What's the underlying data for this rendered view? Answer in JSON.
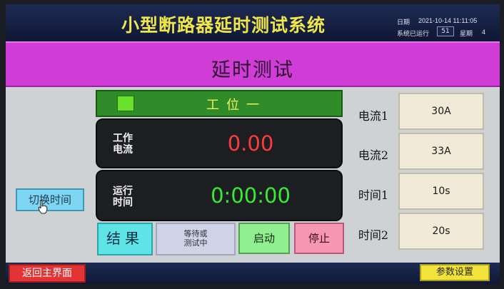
{
  "header": {
    "title": "小型断路器延时测试系统",
    "date_label": "日期",
    "datetime": "2021-10-14 11:11:05",
    "runtime_label": "系统已运行",
    "runtime_value": "51",
    "weekday_label": "星期",
    "weekday_value": "4"
  },
  "page": {
    "title": "延时测试"
  },
  "station": {
    "label": "工位一",
    "indicator_color": "#69e02a"
  },
  "current": {
    "label_line1": "工作",
    "label_line2": "电流",
    "value": "0.00"
  },
  "runtime": {
    "label_line1": "运行",
    "label_line2": "时间",
    "value": "0:00:00"
  },
  "controls": {
    "result_label": "结果",
    "status_line1": "等待或",
    "status_line2": "测试中",
    "start_label": "启动",
    "stop_label": "停止",
    "switch_time_label": "切换时间"
  },
  "params": [
    {
      "label": "电流1",
      "value": "30A"
    },
    {
      "label": "电流2",
      "value": "33A"
    },
    {
      "label": "时间1",
      "value": "10s"
    },
    {
      "label": "时间2",
      "value": "20s"
    }
  ],
  "footer": {
    "back_label": "返回主界面",
    "settings_label": "参数设置"
  },
  "colors": {
    "header_bg": "#0f1735",
    "title_text": "#f0e64a",
    "title_bar": "#d03cd6",
    "station_bar": "#2f8c28",
    "current_value": "#ff3a3a",
    "runtime_value": "#33ee33"
  }
}
